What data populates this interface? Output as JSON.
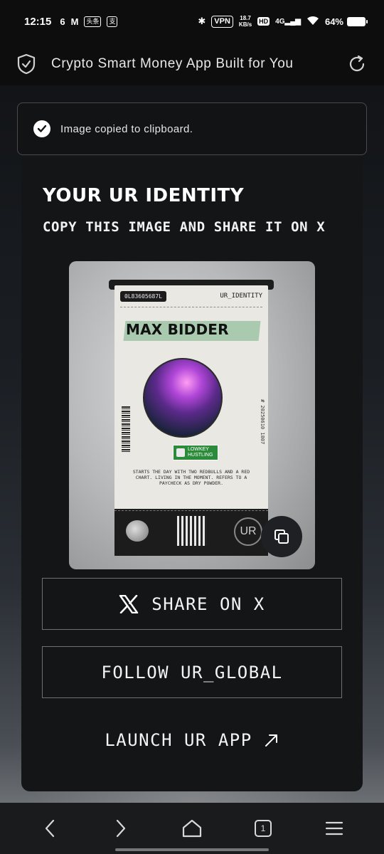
{
  "status_bar": {
    "time": "12:15",
    "vpn": "VPN",
    "speed_value": "18.7",
    "speed_unit": "KB/s",
    "hd": "HD",
    "network": "4G",
    "battery": "64%"
  },
  "header": {
    "title": "Crypto Smart Money App Built for You",
    "shield_icon": "shield-check-icon",
    "reload_icon": "reload-icon"
  },
  "toast": {
    "message": "Image copied to clipboard."
  },
  "modal": {
    "title": "YOUR UR IDENTITY",
    "subtitle": "COPY THIS IMAGE AND SHARE IT ON X",
    "card": {
      "id_code": "0L83605687L",
      "label": "UR_IDENTITY",
      "name": "MAX BIDDER",
      "date_code": "# 20250610 1807",
      "tag": "LOWKEY HUSTLING",
      "bio": "STARTS THE DAY WITH TWO REDBULLS AND A RED CHART. LIVING IN THE MOMENT. REFERS TO A PAYCHECK AS DRY POWDER.",
      "coin": "UR"
    },
    "share_label": "SHARE ON X",
    "follow_label": "FOLLOW UR_GLOBAL",
    "launch_label": "LAUNCH UR APP"
  },
  "nav": {
    "tab_count": "1"
  },
  "colors": {
    "background": "#0d0f12",
    "modal": "#141517",
    "accent_green": "#9fc4a6"
  }
}
